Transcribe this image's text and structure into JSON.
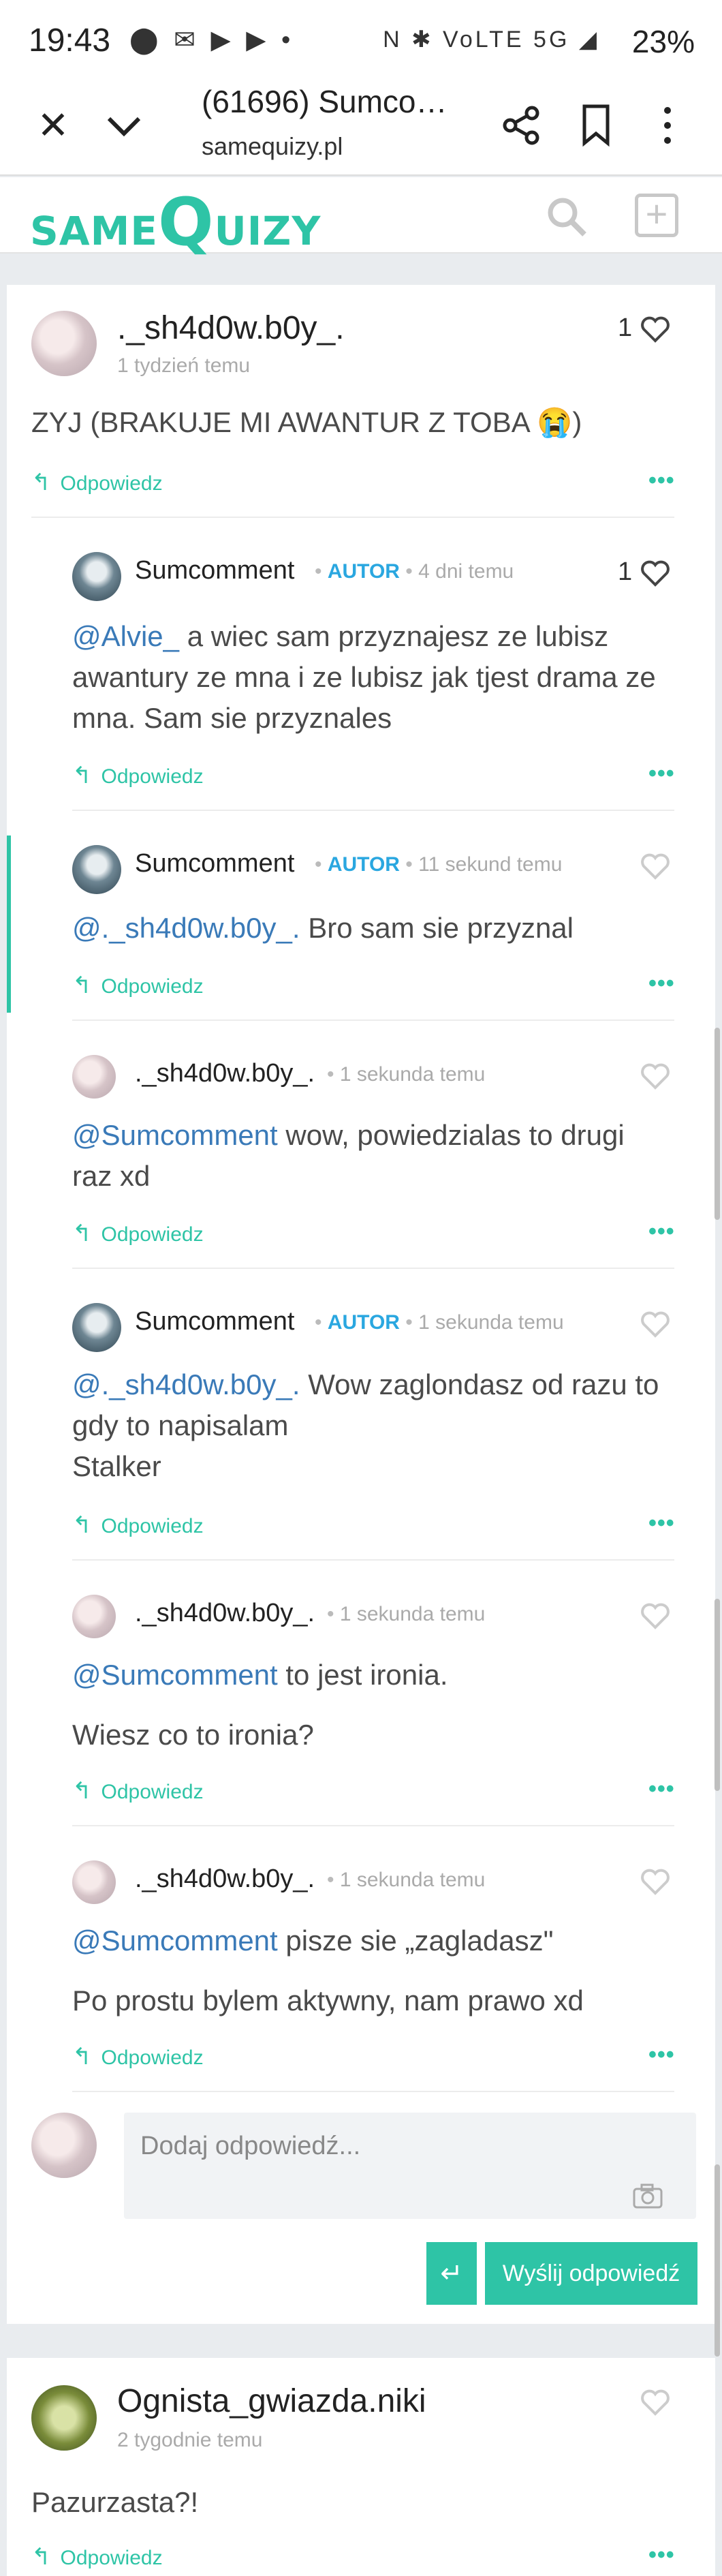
{
  "status_bar": {
    "time": "19:43",
    "left_icons": "⬤ ✉ ▶ ▶ •",
    "right_icons": "N ✱ VoLTE 5G ◢",
    "battery": "23%"
  },
  "browser": {
    "title": "(61696) Sumco…",
    "url": "samequizy.pl"
  },
  "site": {
    "logo_same": "SAME",
    "logo_q": "Q",
    "logo_uizy": "UIZY"
  },
  "thread": {
    "top": {
      "user": "._sh4d0w.b0y_.",
      "time": "1 tydzień temu",
      "likes": "1",
      "text": "ZYJ (BRAKUJE MI AWANTUR Z TOBA 😭)",
      "reply": "Odpowiedz"
    },
    "replies": [
      {
        "user": "Sumcomment",
        "badge": "AUTOR",
        "time": "4 dni temu",
        "likes": "1",
        "mention": "@Alvie_",
        "text": " a wiec sam przyznajesz ze lubisz awantury ze mna i ze lubisz jak tjest drama ze mna. Sam sie przyznales",
        "reply": "Odpowiedz"
      },
      {
        "user": "Sumcomment",
        "badge": "AUTOR",
        "time": "11 sekund temu",
        "likes": "",
        "mention": "@._sh4d0w.b0y_.",
        "text": " Bro sam sie przyznal",
        "reply": "Odpowiedz"
      },
      {
        "user": "._sh4d0w.b0y_.",
        "badge": "",
        "time": "1 sekunda temu",
        "likes": "",
        "mention": "@Sumcomment",
        "text": " wow, powiedzialas to drugi raz xd",
        "reply": "Odpowiedz"
      },
      {
        "user": "Sumcomment",
        "badge": "AUTOR",
        "time": "1 sekunda temu",
        "likes": "",
        "mention": "@._sh4d0w.b0y_.",
        "text": " Wow zaglondasz od razu to gdy to napisalam",
        "text2": "Stalker",
        "reply": "Odpowiedz"
      },
      {
        "user": "._sh4d0w.b0y_.",
        "badge": "",
        "time": "1 sekunda temu",
        "likes": "",
        "mention": "@Sumcomment",
        "text": " to jest ironia.",
        "text2": "Wiesz co to ironia?",
        "reply": "Odpowiedz"
      },
      {
        "user": "._sh4d0w.b0y_.",
        "badge": "",
        "time": "1 sekunda temu",
        "likes": "",
        "mention": "@Sumcomment",
        "text": " pisze sie „zagladasz\"",
        "text2": "Po prostu bylem aktywny, nam prawo xd",
        "reply": "Odpowiedz"
      }
    ],
    "reply_form": {
      "placeholder": "Dodaj odpowiedź...",
      "send_label": "Wyślij odpowiedź",
      "enter_symbol": "↵"
    }
  },
  "next": {
    "user": "Ognista_gwiazda.niki",
    "time": "2 tygodnie temu",
    "text": "Pazurzasta?!",
    "reply": "Odpowiedz"
  },
  "more_symbol": "•••",
  "colors": {
    "accent": "#2ec4a6",
    "badge": "#2aa7e0",
    "mention": "#3a7ab8"
  }
}
